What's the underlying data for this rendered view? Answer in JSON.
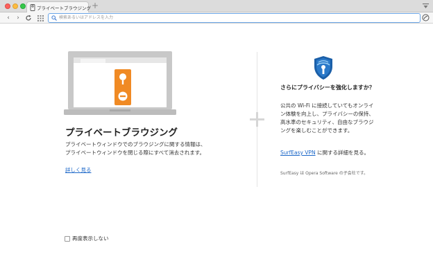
{
  "window": {
    "tab_title": "プライベートブラウジング",
    "new_tab_symbol": "+"
  },
  "toolbar": {
    "back_symbol": "‹",
    "forward_symbol": "›",
    "reload_symbol": "C",
    "url_placeholder": "検索あるいはアドレスを入力"
  },
  "left": {
    "title": "プライベートブラウジング",
    "description": "プライベートウィンドウでのブラウジングに関する情報は、プライベートウィンドウを閉じる際にすべて消去されます。",
    "learn_more": "詳しく見る"
  },
  "right": {
    "heading": "さらにプライバシーを強化しますか？",
    "description": "公共の Wi-Fi に接続していてもオンライン体験を向上し、プライバシーの保持、高水準のセキュリティ、自由なブラウジングを楽しむことができます。",
    "vpn_link": "SurfEasy VPN",
    "vpn_suffix": " に関する詳細を見る。",
    "note": "SurfEasy は Opera Software の子会社です。"
  },
  "footer": {
    "dont_show_again": "再度表示しない"
  },
  "colors": {
    "accent_link": "#1a66c8",
    "door_hanger": "#f08a24",
    "shield": "#1b5fa8",
    "url_focus": "#6aa6e8"
  },
  "icons": {
    "laptop": "laptop-with-door-hanger-icon",
    "shield": "surfeasy-shield-icon",
    "search": "search-icon",
    "grid": "speed-dial-grid-icon"
  }
}
